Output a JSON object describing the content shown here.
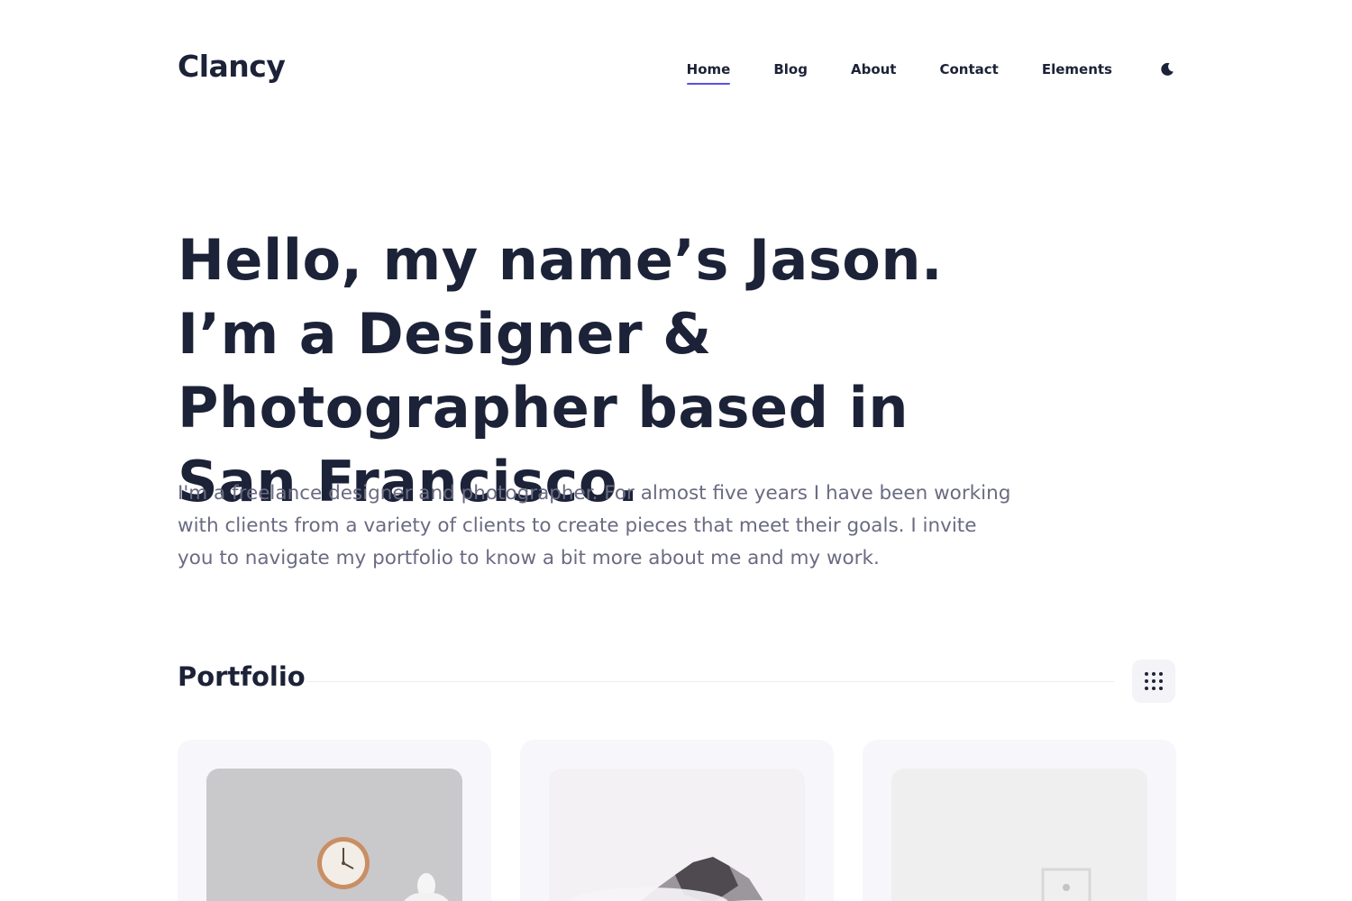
{
  "header": {
    "logo": "Clancy",
    "nav": [
      {
        "label": "Home",
        "active": true
      },
      {
        "label": "Blog",
        "active": false
      },
      {
        "label": "About",
        "active": false
      },
      {
        "label": "Contact",
        "active": false
      },
      {
        "label": "Elements",
        "active": false
      }
    ],
    "theme_icon": "moon-icon"
  },
  "hero": {
    "title": "Hello, my name’s Jason. I’m a Designer & Photographer based in San Francisco.",
    "description": "I'm a freelance designer and photographer. For almost five years I have been working with clients from a variety of clients to create pieces that meet their goals. I invite you to navigate my portfolio to know a bit more about me and my work."
  },
  "portfolio": {
    "title": "Portfolio",
    "view_icon": "grid-icon",
    "items": [
      {
        "image": "clock-on-wall-photo"
      },
      {
        "image": "misty-mountain-photo"
      },
      {
        "image": "minimal-decor-photo"
      }
    ]
  },
  "colors": {
    "text_dark": "#1c2237",
    "text_muted": "#6a6b82",
    "accent": "#5b4fe0",
    "card_bg": "#f7f6fb"
  }
}
